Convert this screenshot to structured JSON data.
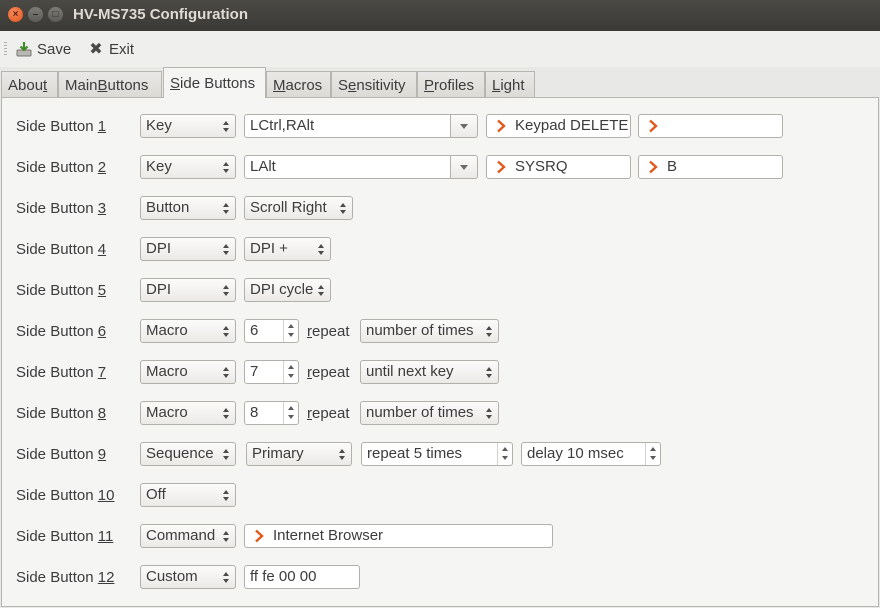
{
  "window": {
    "title": "HV-MS735 Configuration",
    "close": "×",
    "minimize": "–",
    "maximize": "□"
  },
  "toolbar": {
    "save_label": "Save",
    "exit_label": "Exit"
  },
  "tabs": [
    {
      "label": "About",
      "accel": "t"
    },
    {
      "label": "Main Buttons",
      "accel": "B"
    },
    {
      "label": "Side Buttons",
      "accel": "S",
      "active": true
    },
    {
      "label": "Macros",
      "accel": "M"
    },
    {
      "label": "Sensitivity",
      "accel": "e"
    },
    {
      "label": "Profiles",
      "accel": "P"
    },
    {
      "label": "Light",
      "accel": "L"
    }
  ],
  "colors": {
    "accent": "#dd4814",
    "chevron": "#e05a1c"
  },
  "side_buttons": {
    "b1": {
      "label": "Side Button ",
      "num": "1",
      "type": "Key",
      "modifiers": "LCtrl,RAlt",
      "key1": "Keypad DELETE",
      "key2": ""
    },
    "b2": {
      "label": "Side Button ",
      "num": "2",
      "type": "Key",
      "modifiers": "LAlt",
      "key1": "SYSRQ",
      "key2": "B"
    },
    "b3": {
      "label": "Side Button ",
      "num": "3",
      "type": "Button",
      "value": "Scroll Right"
    },
    "b4": {
      "label": "Side Button ",
      "num": "4",
      "type": "DPI",
      "value": "DPI +"
    },
    "b5": {
      "label": "Side Button ",
      "num": "5",
      "type": "DPI",
      "value": "DPI cycle"
    },
    "b6": {
      "label": "Side Button ",
      "num": "6",
      "type": "Macro",
      "macro": "6",
      "repeat_r": "r",
      "repeat_rest": "epeat",
      "mode": "number of times"
    },
    "b7": {
      "label": "Side Button ",
      "num": "7",
      "type": "Macro",
      "macro": "7",
      "repeat_r": "r",
      "repeat_rest": "epeat",
      "mode": "until next key"
    },
    "b8": {
      "label": "Side Button ",
      "num": "8",
      "type": "Macro",
      "macro": "8",
      "repeat_r": "r",
      "repeat_rest": "epeat",
      "mode": "number of times"
    },
    "b9": {
      "label": "Side Button ",
      "num": "9",
      "type": "Sequence",
      "which": "Primary",
      "repeat": "repeat  5  times",
      "delay": "delay  10  msec"
    },
    "b10": {
      "label": "Side Button ",
      "num": "10",
      "type": "Off"
    },
    "b11": {
      "label": "Side Button ",
      "num": "11",
      "type": "Command",
      "command": "Internet Browser"
    },
    "b12": {
      "label": "Side Button ",
      "num": "12",
      "type": "Custom",
      "hex": "ff fe 00 00"
    }
  }
}
